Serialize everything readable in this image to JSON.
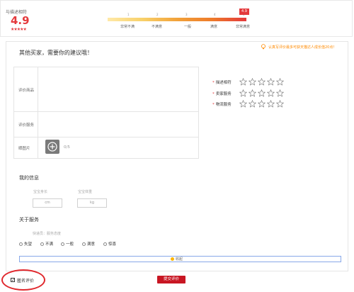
{
  "match": {
    "label": "与描述相符",
    "score": "4.9",
    "stars": "★★★★★"
  },
  "scale": {
    "ticks": [
      "1",
      "2",
      "3",
      "4",
      "5"
    ],
    "labels": [
      "非常不满",
      "不满意",
      "一般",
      "满意",
      "非常满意"
    ],
    "current_score": "4.9"
  },
  "panel": {
    "title": "其他买家，需要你的建议哦！",
    "tip": "认真写评价最多可获天猫达人成长值20点!"
  },
  "form": {
    "rows": [
      "评价商品",
      "评价服务",
      "晒图片"
    ],
    "photo_count": "0/5"
  },
  "ratings": [
    {
      "label": "描述相符"
    },
    {
      "label": "卖家服务"
    },
    {
      "label": "物流服务"
    }
  ],
  "my_info": {
    "title": "我的信息",
    "height_label": "宝宝身长",
    "height_unit": "cm",
    "weight_label": "宝宝体重",
    "weight_unit": "kg"
  },
  "service": {
    "title": "关于服务",
    "subtitle": "快递员：服务态度",
    "options": [
      "失望",
      "不满",
      "一般",
      "满意",
      "惊喜"
    ]
  },
  "collapse_label": "收起",
  "anonymous_label": "匿名评价",
  "submit_label": "提交评价",
  "colors": {
    "accent_red": "#e4393c",
    "submit_red": "#c81623",
    "tip_orange": "#ff8a00"
  }
}
